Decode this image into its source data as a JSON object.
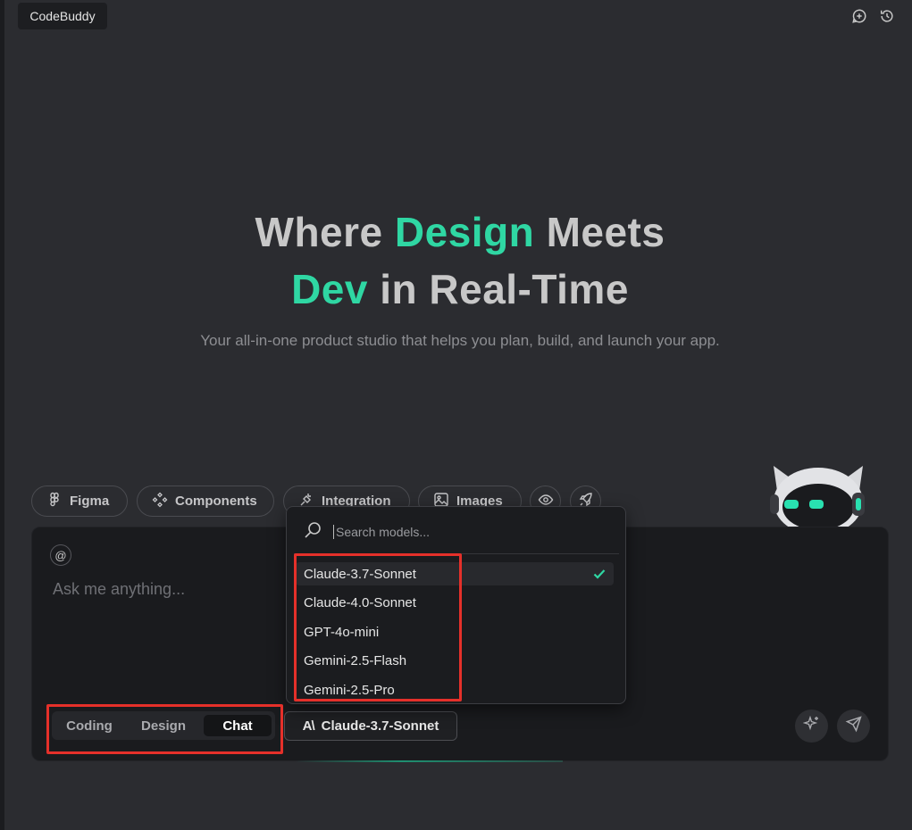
{
  "app": {
    "tab_title": "CodeBuddy"
  },
  "header": {
    "icons": [
      "new-chat-icon",
      "history-icon"
    ]
  },
  "hero": {
    "line1_prefix": "Where",
    "line1_accent": "Design",
    "line1_suffix": "Meets",
    "line2_accent": "Dev",
    "line2_suffix": "in Real-Time",
    "subtitle": "Your all-in-one product studio that helps you plan, build, and launch your app."
  },
  "chips": {
    "figma": "Figma",
    "components": "Components",
    "integration": "Integration",
    "images": "Images"
  },
  "input": {
    "at_symbol": "@",
    "placeholder": "Ask me anything..."
  },
  "modes": {
    "coding": "Coding",
    "design": "Design",
    "chat": "Chat",
    "active": "Chat"
  },
  "model_selector": {
    "current": "Claude-3.7-Sonnet",
    "logo_text": "A\\"
  },
  "dropdown": {
    "search_placeholder": "Search models...",
    "models": [
      "Claude-3.7-Sonnet",
      "Claude-4.0-Sonnet",
      "GPT-4o-mini",
      "Gemini-2.5-Flash",
      "Gemini-2.5-Pro"
    ],
    "selected": "Claude-3.7-Sonnet"
  },
  "colors": {
    "accent": "#2fd7a3",
    "background": "#2b2c30",
    "panel": "#1a1b1e",
    "highlight_box": "#e5302a"
  }
}
